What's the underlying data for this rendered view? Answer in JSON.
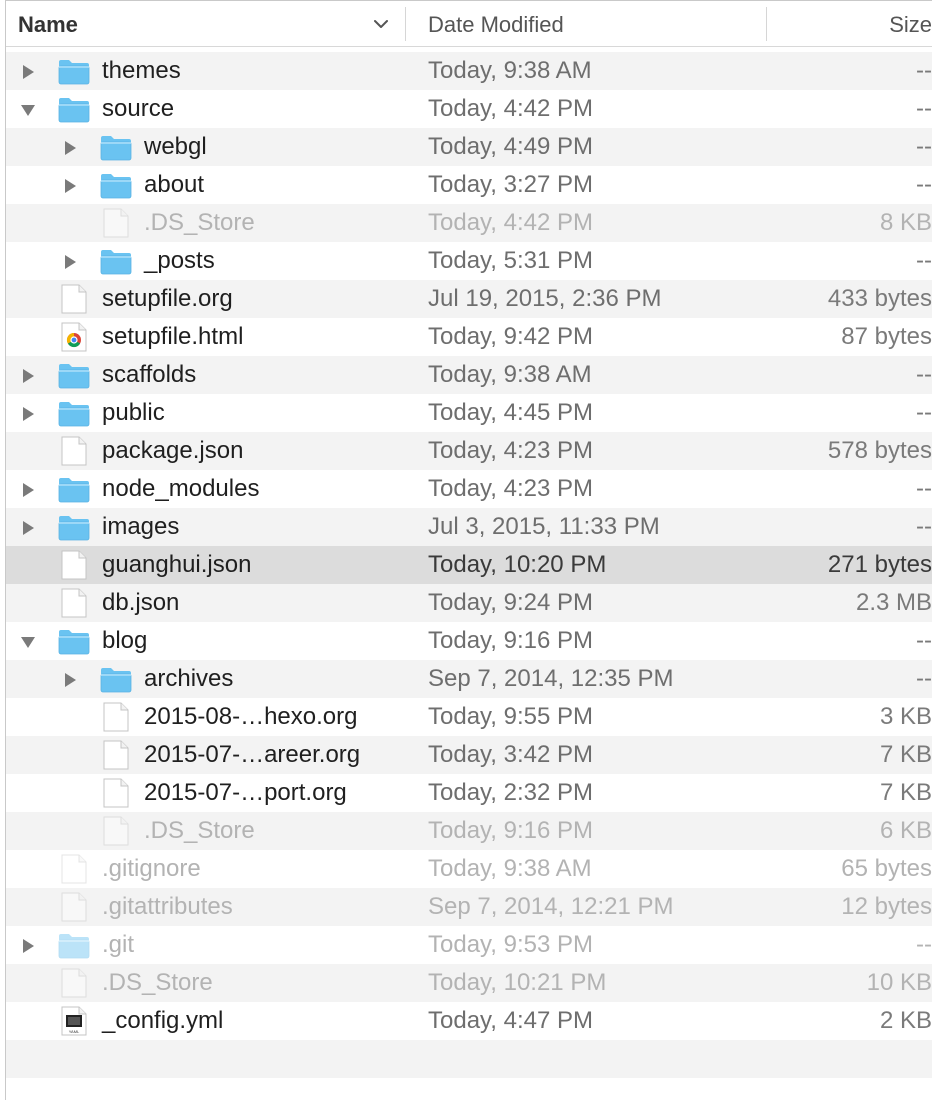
{
  "header": {
    "name_label": "Name",
    "date_label": "Date Modified",
    "size_label": "Size"
  },
  "colors": {
    "folder": "#6ac3f1",
    "stripe": "#f3f3f3",
    "selected": "#dcdcdc"
  },
  "rows": [
    {
      "name": "themes",
      "date": "Today, 9:38 AM",
      "size": "--",
      "type": "folder",
      "depth": 0,
      "disclosure": "collapsed",
      "dim": false
    },
    {
      "name": "source",
      "date": "Today, 4:42 PM",
      "size": "--",
      "type": "folder",
      "depth": 0,
      "disclosure": "expanded",
      "dim": false
    },
    {
      "name": "webgl",
      "date": "Today, 4:49 PM",
      "size": "--",
      "type": "folder",
      "depth": 1,
      "disclosure": "collapsed",
      "dim": false
    },
    {
      "name": "about",
      "date": "Today, 3:27 PM",
      "size": "--",
      "type": "folder",
      "depth": 1,
      "disclosure": "collapsed",
      "dim": false
    },
    {
      "name": ".DS_Store",
      "date": "Today, 4:42 PM",
      "size": "8 KB",
      "type": "file",
      "depth": 1,
      "disclosure": "none",
      "dim": true
    },
    {
      "name": "_posts",
      "date": "Today, 5:31 PM",
      "size": "--",
      "type": "folder",
      "depth": 1,
      "disclosure": "collapsed",
      "dim": false
    },
    {
      "name": "setupfile.org",
      "date": "Jul 19, 2015, 2:36 PM",
      "size": "433 bytes",
      "type": "file",
      "depth": 0,
      "disclosure": "none",
      "dim": false
    },
    {
      "name": "setupfile.html",
      "date": "Today, 9:42 PM",
      "size": "87 bytes",
      "type": "chrome",
      "depth": 0,
      "disclosure": "none",
      "dim": false
    },
    {
      "name": "scaffolds",
      "date": "Today, 9:38 AM",
      "size": "--",
      "type": "folder",
      "depth": 0,
      "disclosure": "collapsed",
      "dim": false
    },
    {
      "name": "public",
      "date": "Today, 4:45 PM",
      "size": "--",
      "type": "folder",
      "depth": 0,
      "disclosure": "collapsed",
      "dim": false
    },
    {
      "name": "package.json",
      "date": "Today, 4:23 PM",
      "size": "578 bytes",
      "type": "file",
      "depth": 0,
      "disclosure": "none",
      "dim": false
    },
    {
      "name": "node_modules",
      "date": "Today, 4:23 PM",
      "size": "--",
      "type": "folder",
      "depth": 0,
      "disclosure": "collapsed",
      "dim": false
    },
    {
      "name": "images",
      "date": "Jul 3, 2015, 11:33 PM",
      "size": "--",
      "type": "folder",
      "depth": 0,
      "disclosure": "collapsed",
      "dim": false
    },
    {
      "name": "guanghui.json",
      "date": "Today, 10:20 PM",
      "size": "271 bytes",
      "type": "file",
      "depth": 0,
      "disclosure": "none",
      "dim": false,
      "selected": true
    },
    {
      "name": "db.json",
      "date": "Today, 9:24 PM",
      "size": "2.3 MB",
      "type": "file",
      "depth": 0,
      "disclosure": "none",
      "dim": false
    },
    {
      "name": "blog",
      "date": "Today, 9:16 PM",
      "size": "--",
      "type": "folder",
      "depth": 0,
      "disclosure": "expanded",
      "dim": false
    },
    {
      "name": "archives",
      "date": "Sep 7, 2014, 12:35 PM",
      "size": "--",
      "type": "folder",
      "depth": 1,
      "disclosure": "collapsed",
      "dim": false
    },
    {
      "name": "2015-08-…hexo.org",
      "date": "Today, 9:55 PM",
      "size": "3 KB",
      "type": "file",
      "depth": 1,
      "disclosure": "none",
      "dim": false
    },
    {
      "name": "2015-07-…areer.org",
      "date": "Today, 3:42 PM",
      "size": "7 KB",
      "type": "file",
      "depth": 1,
      "disclosure": "none",
      "dim": false
    },
    {
      "name": "2015-07-…port.org",
      "date": "Today, 2:32 PM",
      "size": "7 KB",
      "type": "file",
      "depth": 1,
      "disclosure": "none",
      "dim": false
    },
    {
      "name": ".DS_Store",
      "date": "Today, 9:16 PM",
      "size": "6 KB",
      "type": "file",
      "depth": 1,
      "disclosure": "none",
      "dim": true
    },
    {
      "name": ".gitignore",
      "date": "Today, 9:38 AM",
      "size": "65 bytes",
      "type": "file",
      "depth": 0,
      "disclosure": "none",
      "dim": true
    },
    {
      "name": ".gitattributes",
      "date": "Sep 7, 2014, 12:21 PM",
      "size": "12 bytes",
      "type": "file",
      "depth": 0,
      "disclosure": "none",
      "dim": true
    },
    {
      "name": ".git",
      "date": "Today, 9:53 PM",
      "size": "--",
      "type": "folder",
      "depth": 0,
      "disclosure": "collapsed",
      "dim": true
    },
    {
      "name": ".DS_Store",
      "date": "Today, 10:21 PM",
      "size": "10 KB",
      "type": "file",
      "depth": 0,
      "disclosure": "none",
      "dim": true
    },
    {
      "name": "_config.yml",
      "date": "Today, 4:47 PM",
      "size": "2 KB",
      "type": "yaml",
      "depth": 0,
      "disclosure": "none",
      "dim": false
    }
  ]
}
